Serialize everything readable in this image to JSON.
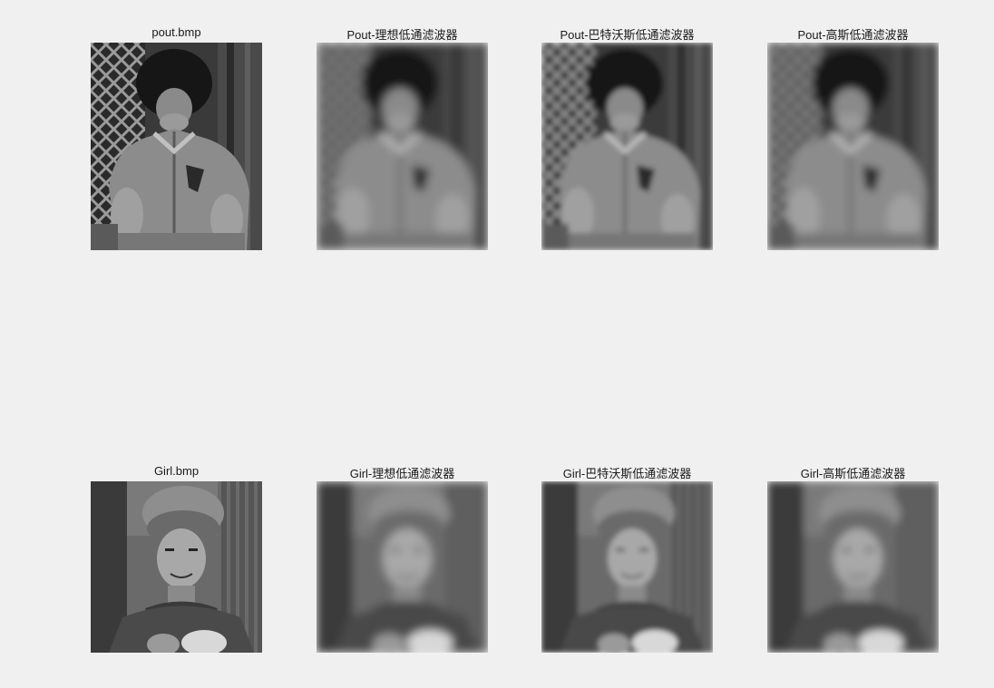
{
  "figure": {
    "background": "#f0f0f0",
    "row1": {
      "titles": [
        "pout.bmp",
        "Pout-理想低通滤波器",
        "Pout-巴特沃斯低通滤波器",
        "Pout-高斯低通滤波器"
      ]
    },
    "row2": {
      "titles": [
        "Girl.bmp",
        "Girl-理想低通滤波器",
        "Girl-巴特沃斯低通滤波器",
        "Girl-高斯低通滤波器"
      ]
    }
  }
}
